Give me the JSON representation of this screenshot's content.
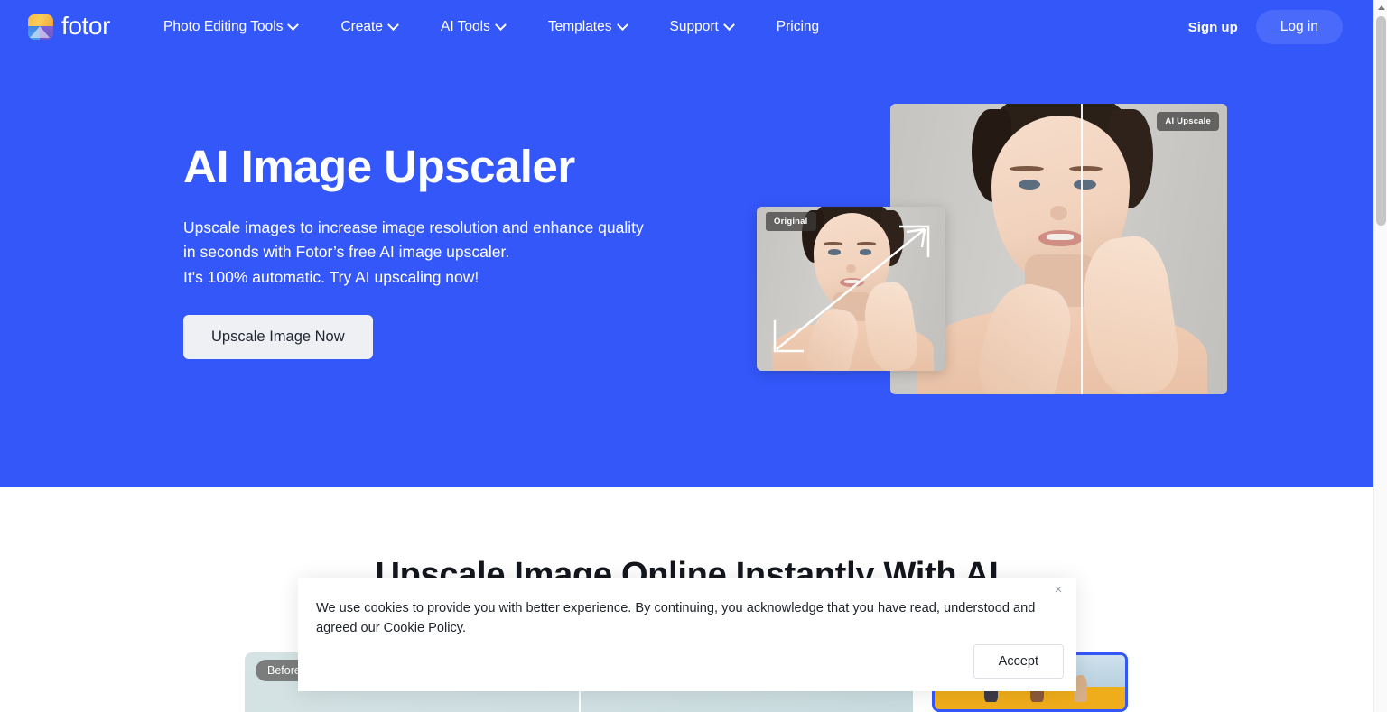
{
  "brand": {
    "name": "fotor",
    "icon": "fotor-logo-icon"
  },
  "nav": {
    "items": [
      {
        "label": "Photo Editing Tools",
        "has_chevron": true
      },
      {
        "label": "Create",
        "has_chevron": true
      },
      {
        "label": "AI Tools",
        "has_chevron": true
      },
      {
        "label": "Templates",
        "has_chevron": true
      },
      {
        "label": "Support",
        "has_chevron": true
      },
      {
        "label": "Pricing",
        "has_chevron": false
      }
    ],
    "signup_label": "Sign up",
    "login_label": "Log in"
  },
  "hero": {
    "title": "AI Image Upscaler",
    "subtitle_line1": "Upscale images to increase image resolution and enhance quality",
    "subtitle_line2": "in seconds with Fotor’s free AI image upscaler.",
    "subtitle_line3": "It's 100% automatic. Try AI upscaling now!",
    "cta_label": "Upscale Image Now",
    "badge_ai": "AI Upscale",
    "badge_original": "Original"
  },
  "section2": {
    "heading": "Upscale Image Online Instantly With AI",
    "before_badge": "Before"
  },
  "cookie": {
    "text_before_link": "We use cookies to provide you with better experience. By continuing, you acknowledge that you have read, understood and agreed our ",
    "link_label": "Cookie Policy",
    "text_after_link": ".",
    "accept_label": "Accept",
    "close_icon": "×"
  },
  "colors": {
    "brand_blue": "#3457fa",
    "login_blue": "#4a6afb",
    "cta_bg": "#eef0f4",
    "text_dark": "#20242c"
  }
}
